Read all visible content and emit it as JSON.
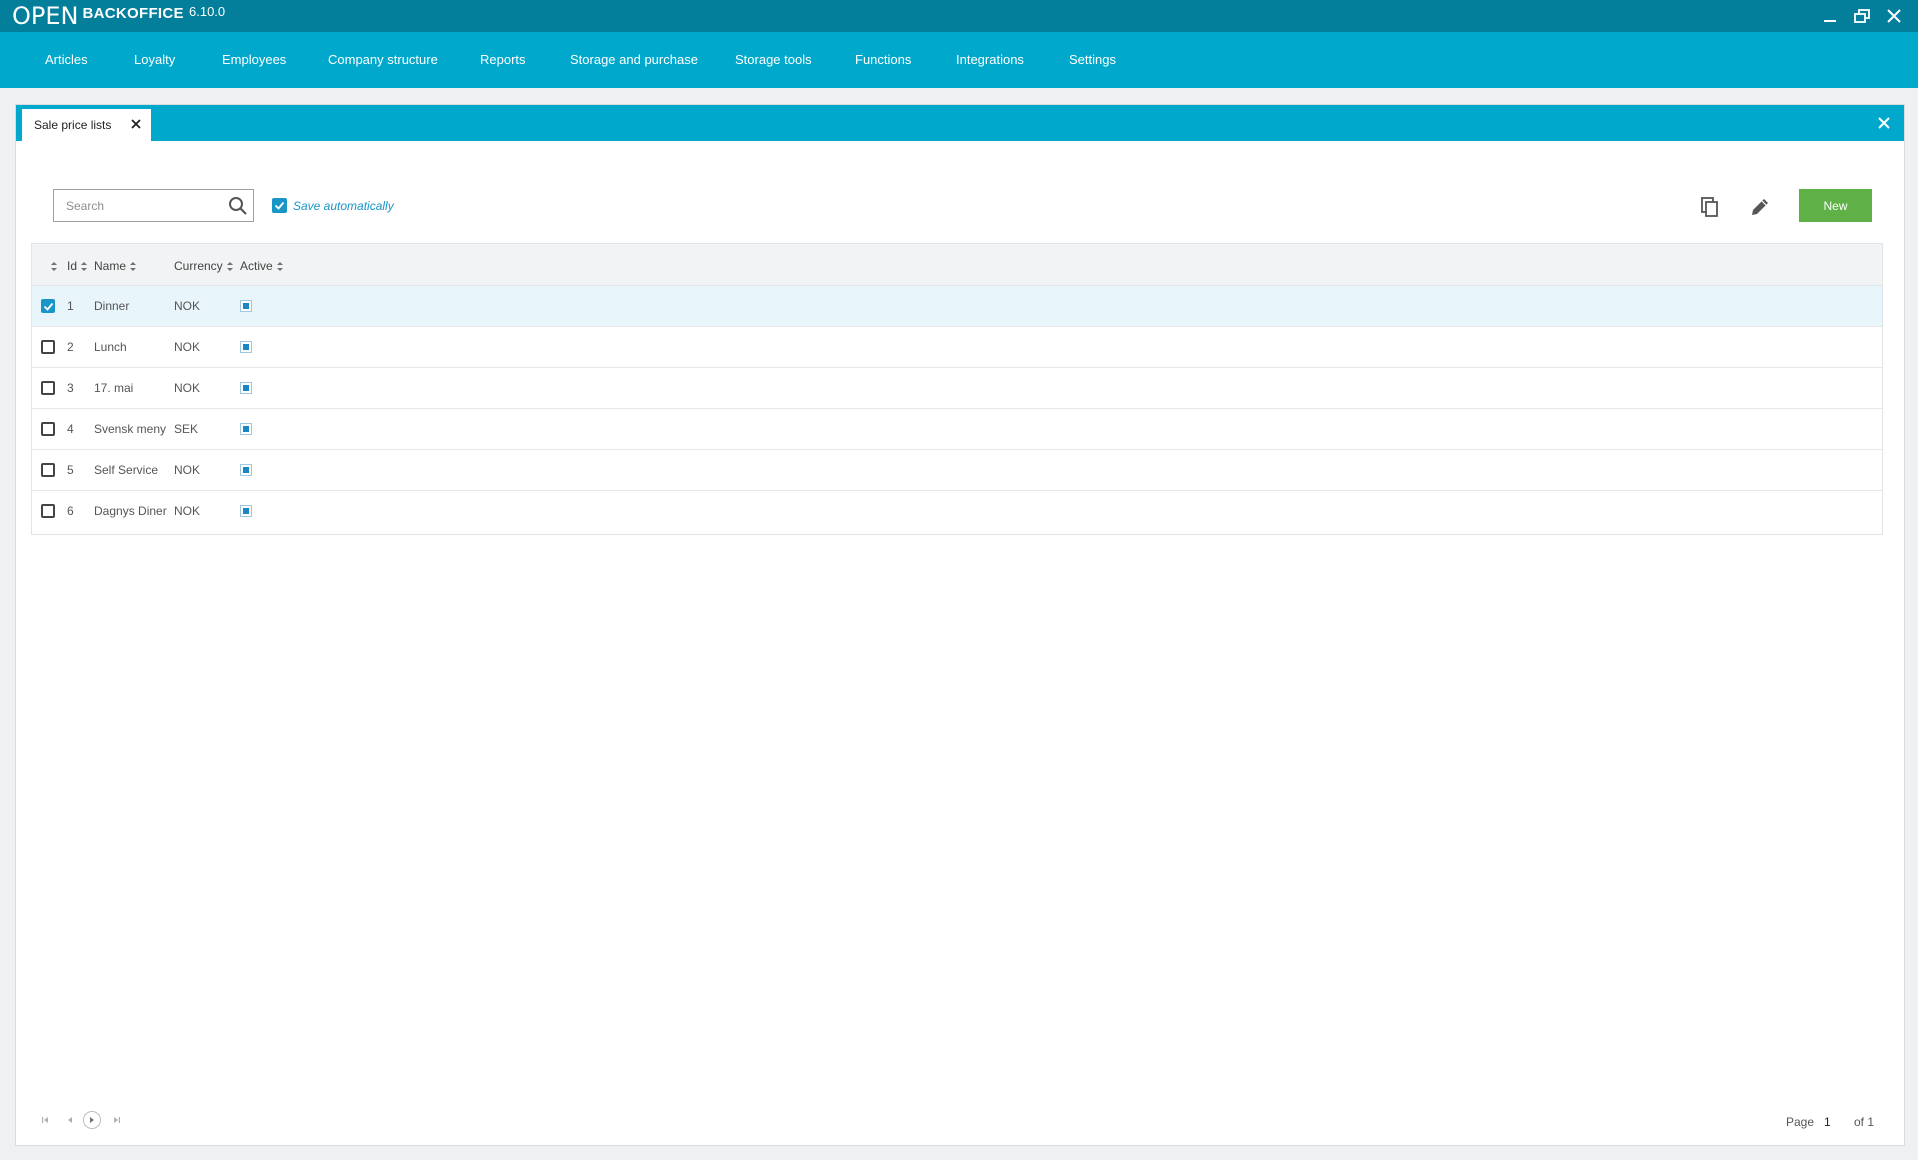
{
  "app": {
    "logo_mark": "OPEN",
    "logo_text": "BACKOFFICE",
    "version": "6.10.0"
  },
  "nav": {
    "items": [
      {
        "label": "Articles"
      },
      {
        "label": "Loyalty"
      },
      {
        "label": "Employees"
      },
      {
        "label": "Company structure"
      },
      {
        "label": "Reports"
      },
      {
        "label": "Storage and purchase"
      },
      {
        "label": "Storage tools"
      },
      {
        "label": "Functions"
      },
      {
        "label": "Integrations"
      },
      {
        "label": "Settings"
      }
    ]
  },
  "tab": {
    "label": "Sale price lists"
  },
  "toolbar": {
    "search_placeholder": "Search",
    "search_value": "",
    "save_auto_label": "Save automatically",
    "save_auto_checked": true,
    "new_label": "New"
  },
  "grid": {
    "columns": {
      "id": "Id",
      "name": "Name",
      "currency": "Currency",
      "active": "Active"
    },
    "rows": [
      {
        "id": "1",
        "name": "Dinner",
        "currency": "NOK",
        "active": true,
        "checked": true
      },
      {
        "id": "2",
        "name": "Lunch",
        "currency": "NOK",
        "active": true,
        "checked": false
      },
      {
        "id": "3",
        "name": "17. mai",
        "currency": "NOK",
        "active": true,
        "checked": false
      },
      {
        "id": "4",
        "name": "Svensk meny",
        "currency": "SEK",
        "active": true,
        "checked": false
      },
      {
        "id": "5",
        "name": "Self Service",
        "currency": "NOK",
        "active": true,
        "checked": false
      },
      {
        "id": "6",
        "name": "Dagnys Diner",
        "currency": "NOK",
        "active": true,
        "checked": false
      }
    ]
  },
  "pager": {
    "page_label": "Page",
    "page": "1",
    "of_label": "of 1"
  },
  "colors": {
    "titlebar": "#037f9c",
    "nav": "#00a9cc",
    "accent": "#1a95c8",
    "new_button": "#5fb046"
  }
}
